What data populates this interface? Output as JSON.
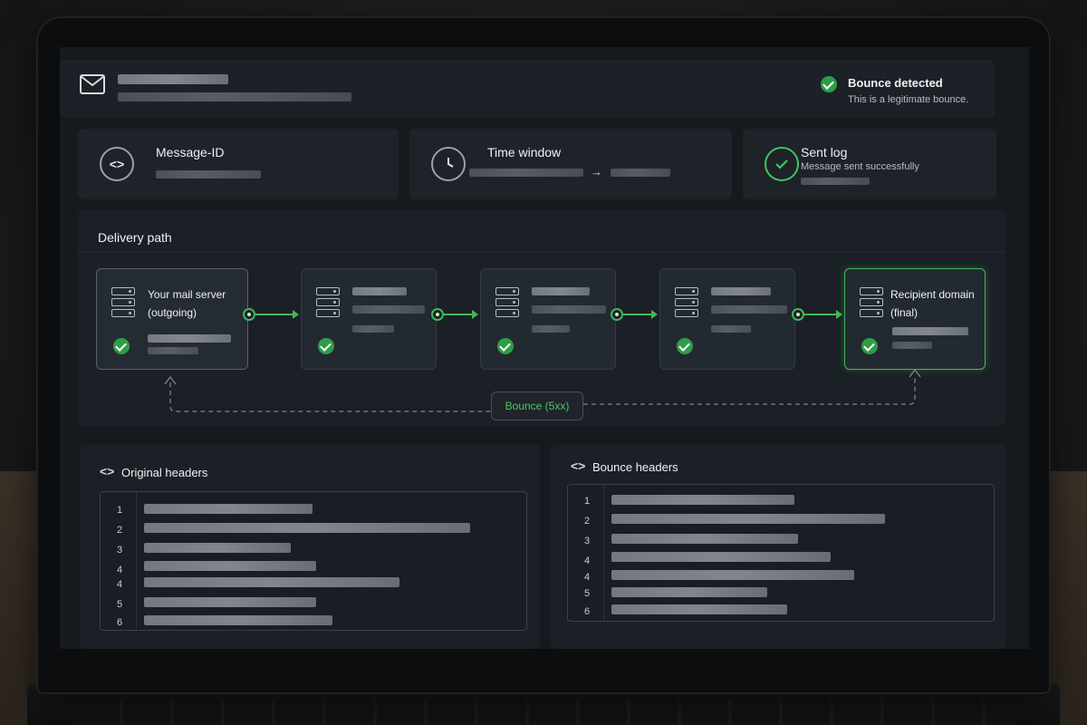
{
  "status": {
    "title": "Bounce detected",
    "subtitle": "This is a legitimate bounce.",
    "icon": "check-circle-icon"
  },
  "info_cards": [
    {
      "title": "Message-ID",
      "subtitle": "",
      "icon": "code-icon"
    },
    {
      "title": "Time window",
      "subtitle": "",
      "icon": "clock-icon",
      "arrow": "→"
    },
    {
      "title": "Sent log",
      "subtitle": "Message sent successfully",
      "icon": "check-circle-icon"
    }
  ],
  "delivery_path": {
    "title": "Delivery path",
    "nodes": [
      {
        "line1": "Your mail server",
        "line2": "(outgoing)"
      },
      {
        "line1": "",
        "line2": ""
      },
      {
        "line1": "",
        "line2": ""
      },
      {
        "line1": "",
        "line2": ""
      },
      {
        "line1": "Recipient domain",
        "line2": "(final)"
      }
    ],
    "bounce_label": "Bounce (5xx)"
  },
  "original_headers": {
    "title": "Original headers",
    "line_numbers": [
      "1",
      "2",
      "3",
      "4",
      "4",
      "5",
      "6"
    ]
  },
  "bounce_headers": {
    "title": "Bounce headers",
    "line_numbers": [
      "1",
      "2",
      "3",
      "4",
      "4",
      "5",
      "6"
    ]
  },
  "colors": {
    "accent_green": "#3fb85a",
    "background": "#161a1f",
    "card": "#1e232a"
  }
}
